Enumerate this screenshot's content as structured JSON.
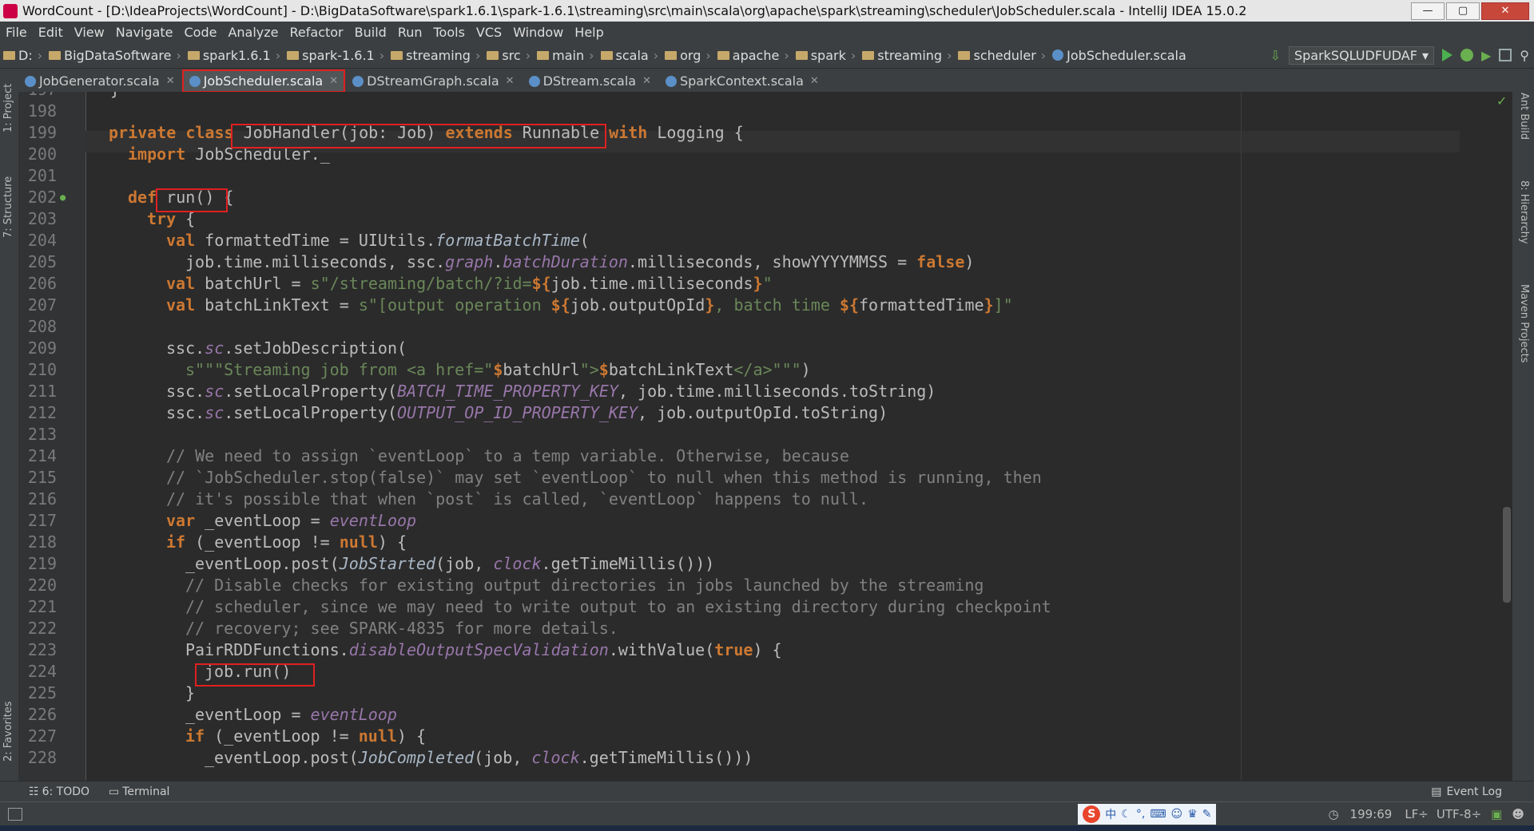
{
  "window": {
    "title": "WordCount - [D:\\IdeaProjects\\WordCount] - D:\\BigDataSoftware\\spark1.6.1\\spark-1.6.1\\streaming\\src\\main\\scala\\org\\apache\\spark\\streaming\\scheduler\\JobScheduler.scala - IntelliJ IDEA 15.0.2"
  },
  "menu": [
    "File",
    "Edit",
    "View",
    "Navigate",
    "Code",
    "Analyze",
    "Refactor",
    "Build",
    "Run",
    "Tools",
    "VCS",
    "Window",
    "Help"
  ],
  "breadcrumbs": [
    "D:",
    "BigDataSoftware",
    "spark1.6.1",
    "spark-1.6.1",
    "streaming",
    "src",
    "main",
    "scala",
    "org",
    "apache",
    "spark",
    "streaming",
    "scheduler",
    "JobScheduler.scala"
  ],
  "run_config": "SparkSQLUDFUDAF",
  "tabs": [
    {
      "label": "JobGenerator.scala",
      "active": false
    },
    {
      "label": "JobScheduler.scala",
      "active": true
    },
    {
      "label": "DStreamGraph.scala",
      "active": false
    },
    {
      "label": "DStream.scala",
      "active": false
    },
    {
      "label": "SparkContext.scala",
      "active": false
    }
  ],
  "left_tools": {
    "project": "1: Project",
    "structure": "7: Structure",
    "favorites": "2: Favorites"
  },
  "right_tools": {
    "ant": "Ant Build",
    "hierarchy": "8: Hierarchy",
    "maven": "Maven Projects"
  },
  "line_numbers": [
    "197",
    "198",
    "199",
    "200",
    "201",
    "202",
    "203",
    "204",
    "205",
    "206",
    "207",
    "208",
    "209",
    "210",
    "211",
    "212",
    "213",
    "214",
    "215",
    "216",
    "217",
    "218",
    "219",
    "220",
    "221",
    "222",
    "223",
    "224",
    "225",
    "226",
    "227",
    "228"
  ],
  "code": {
    "l197": "}",
    "l199": [
      "private class ",
      "JobHandler(job: Job) ",
      "extends ",
      "Runnable ",
      "with ",
      "Logging {"
    ],
    "l200": [
      "import ",
      "JobScheduler._"
    ],
    "l202": [
      "def ",
      "run() {"
    ],
    "l203": [
      "try ",
      "{"
    ],
    "l204": [
      "val ",
      "formattedTime = UIUtils.",
      "formatBatchTime",
      "("
    ],
    "l205": [
      "job.time.milliseconds, ssc.",
      "graph",
      ".",
      "batchDuration",
      ".milliseconds, showYYYYMMSS = ",
      "false",
      ")"
    ],
    "l206": [
      "val ",
      "batchUrl = ",
      "s\"/streaming/batch/?id=",
      "${",
      "job.time.milliseconds",
      "}",
      "\""
    ],
    "l207": [
      "val ",
      "batchLinkText = ",
      "s\"[output operation ",
      "${",
      "job.outputOpId",
      "}",
      ", batch time ",
      "${",
      "formattedTime",
      "}",
      "]\""
    ],
    "l209": [
      "ssc.",
      "sc",
      ".setJobDescription("
    ],
    "l210": [
      "s\"\"\"Streaming job from <a href=\"",
      "$",
      "batchUrl",
      "\">",
      "$",
      "batchLinkText",
      "</a>\"\"\"",
      ")"
    ],
    "l211": [
      "ssc.",
      "sc",
      ".setLocalProperty(",
      "BATCH_TIME_PROPERTY_KEY",
      ", job.time.milliseconds.toString)"
    ],
    "l212": [
      "ssc.",
      "sc",
      ".setLocalProperty(",
      "OUTPUT_OP_ID_PROPERTY_KEY",
      ", job.outputOpId.toString)"
    ],
    "l214": "// We need to assign `eventLoop` to a temp variable. Otherwise, because",
    "l215": "// `JobScheduler.stop(false)` may set `eventLoop` to null when this method is running, then",
    "l216": "// it's possible that when `post` is called, `eventLoop` happens to null.",
    "l217": [
      "var ",
      "_eventLoop = ",
      "eventLoop"
    ],
    "l218": [
      "if ",
      "(_eventLoop != ",
      "null",
      ") {"
    ],
    "l219": [
      "_eventLoop.post(",
      "JobStarted",
      "(job, ",
      "clock",
      ".getTimeMillis()))"
    ],
    "l220": "// Disable checks for existing output directories in jobs launched by the streaming",
    "l221": "// scheduler, since we may need to write output to an existing directory during checkpoint",
    "l222": "// recovery; see SPARK-4835 for more details.",
    "l223": [
      "PairRDDFunctions.",
      "disableOutputSpecValidation",
      ".withValue(",
      "true",
      ") {"
    ],
    "l224": "job.run()",
    "l225": "}",
    "l226": [
      "_eventLoop = ",
      "eventLoop"
    ],
    "l227": [
      "if ",
      "(_eventLoop != ",
      "null",
      ") {"
    ],
    "l228": [
      "_eventLoop.post(",
      "JobCompleted",
      "(job, ",
      "clock",
      ".getTimeMillis()))"
    ]
  },
  "bottom_tools": {
    "todo": "6: TODO",
    "terminal": "Terminal",
    "event_log": "Event Log"
  },
  "status": {
    "position": "199:69",
    "line_sep": "LF÷",
    "encoding": "UTF-8÷",
    "ime": "中"
  }
}
